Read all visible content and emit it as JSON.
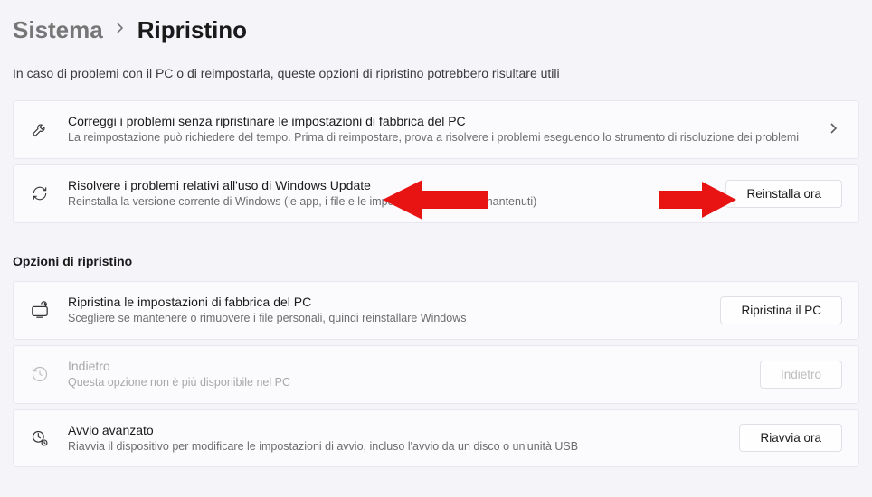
{
  "breadcrumb": {
    "parent": "Sistema",
    "current": "Ripristino"
  },
  "subtitle": "In caso di problemi con il PC o di reimpostarla, queste opzioni di ripristino potrebbero risultare utili",
  "section1": {
    "items": [
      {
        "title": "Correggi i problemi senza ripristinare le impostazioni di fabbrica del PC",
        "desc": "La reimpostazione può richiedere del tempo. Prima di reimpostare, prova a risolvere i problemi eseguendo lo strumento di risoluzione dei problemi"
      },
      {
        "title": "Risolvere i problemi relativi all'uso di Windows Update",
        "desc": "Reinstalla la versione corrente di Windows (le app, i file e le impostazioni verranno mantenuti)",
        "button": "Reinstalla ora"
      }
    ]
  },
  "section2": {
    "header": "Opzioni di ripristino",
    "items": [
      {
        "title": "Ripristina le impostazioni di fabbrica del PC",
        "desc": "Scegliere se mantenere o rimuovere i file personali, quindi reinstallare Windows",
        "button": "Ripristina il PC"
      },
      {
        "title": "Indietro",
        "desc": "Questa opzione non è più disponibile nel PC",
        "button": "Indietro"
      },
      {
        "title": "Avvio avanzato",
        "desc": "Riavvia il dispositivo per modificare le impostazioni di avvio, incluso l'avvio da un disco o un'unità USB",
        "button": "Riavvia ora"
      }
    ]
  }
}
